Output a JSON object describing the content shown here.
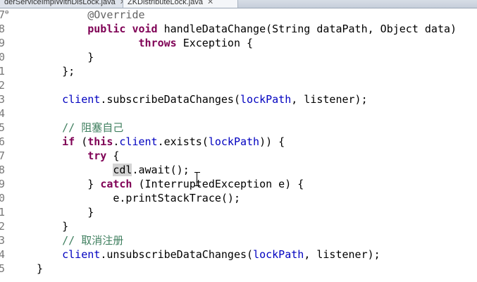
{
  "tabs": [
    {
      "label": "derServiceImplWithDisLock.java",
      "close": "✕"
    },
    {
      "label": "ZKDistributeLock.java",
      "close": "✕"
    }
  ],
  "lines": [
    {
      "num": "7",
      "fold": "⊖",
      "tokens": [
        [
          "",
          "        "
        ],
        [
          "ann",
          "@Override"
        ]
      ]
    },
    {
      "num": "8",
      "tokens": [
        [
          "",
          "        "
        ],
        [
          "kw",
          "public"
        ],
        [
          "",
          " "
        ],
        [
          "kw",
          "void"
        ],
        [
          "",
          " handleDataChange(String dataPath, Object data)"
        ]
      ]
    },
    {
      "num": "9",
      "tokens": [
        [
          "",
          "                "
        ],
        [
          "kw",
          "throws"
        ],
        [
          "",
          " Exception {"
        ]
      ]
    },
    {
      "num": "0",
      "tokens": [
        [
          "",
          "        }"
        ]
      ]
    },
    {
      "num": "1",
      "tokens": [
        [
          "",
          "    };"
        ]
      ]
    },
    {
      "num": "2",
      "tokens": []
    },
    {
      "num": "3",
      "tokens": [
        [
          "",
          "    "
        ],
        [
          "fld",
          "client"
        ],
        [
          "",
          ".subscribeDataChanges("
        ],
        [
          "fld",
          "lockPath"
        ],
        [
          "",
          ", listener);"
        ]
      ]
    },
    {
      "num": "4",
      "tokens": []
    },
    {
      "num": "5",
      "tokens": [
        [
          "",
          "    "
        ],
        [
          "cmt",
          "// 阻塞自己"
        ]
      ]
    },
    {
      "num": "6",
      "tokens": [
        [
          "",
          "    "
        ],
        [
          "kw",
          "if"
        ],
        [
          "",
          " ("
        ],
        [
          "kw",
          "this"
        ],
        [
          "",
          "."
        ],
        [
          "fld",
          "client"
        ],
        [
          "",
          ".exists("
        ],
        [
          "fld",
          "lockPath"
        ],
        [
          "",
          ")) {"
        ]
      ]
    },
    {
      "num": "7",
      "tokens": [
        [
          "",
          "        "
        ],
        [
          "kw",
          "try"
        ],
        [
          "",
          " {"
        ]
      ]
    },
    {
      "num": "8",
      "tokens": [
        [
          "",
          "            "
        ],
        [
          "hl",
          "cdl"
        ],
        [
          "",
          ".await();"
        ]
      ]
    },
    {
      "num": "9",
      "tokens": [
        [
          "",
          "        } "
        ],
        [
          "kw",
          "catch"
        ],
        [
          "",
          " (InterruptedException e) {"
        ]
      ]
    },
    {
      "num": "0",
      "tokens": [
        [
          "",
          "            e.printStackTrace();"
        ]
      ]
    },
    {
      "num": "1",
      "tokens": [
        [
          "",
          "        }"
        ]
      ]
    },
    {
      "num": "2",
      "tokens": [
        [
          "",
          "    }"
        ]
      ]
    },
    {
      "num": "3",
      "tokens": [
        [
          "",
          "    "
        ],
        [
          "cmt",
          "// 取消注册"
        ]
      ]
    },
    {
      "num": "4",
      "tokens": [
        [
          "",
          "    "
        ],
        [
          "fld",
          "client"
        ],
        [
          "",
          ".unsubscribeDataChanges("
        ],
        [
          "fld",
          "lockPath"
        ],
        [
          "",
          ", listener);"
        ]
      ]
    },
    {
      "num": "5",
      "tokens": [
        [
          "",
          "}"
        ]
      ]
    }
  ]
}
